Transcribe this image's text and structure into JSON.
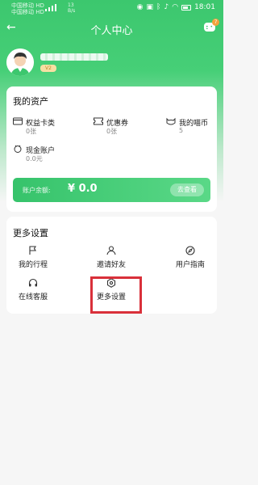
{
  "status_bar": {
    "carrier1": "中国移动 HD",
    "carrier2": "中国移动 HD",
    "speed": "13",
    "speed_unit": "B/s",
    "time": "18:01"
  },
  "nav": {
    "title": "个人中心",
    "chat_badge": "7"
  },
  "profile": {
    "level_badge": "V2"
  },
  "assets": {
    "title": "我的资产",
    "items": [
      {
        "label": "权益卡类",
        "value": "0张",
        "icon": "card-icon"
      },
      {
        "label": "优惠券",
        "value": "0张",
        "icon": "coupon-icon"
      },
      {
        "label": "我的喵币",
        "value": "5",
        "icon": "cat-coin-icon"
      },
      {
        "label": "现金账户",
        "value": "0.0元",
        "icon": "wallet-icon"
      }
    ],
    "balance": {
      "label": "账户余额:",
      "value": "¥ 0.0",
      "button": "去查看"
    }
  },
  "more_settings": {
    "title": "更多设置",
    "items": [
      {
        "label": "我的行程",
        "icon": "flag-icon"
      },
      {
        "label": "邀请好友",
        "icon": "invite-icon"
      },
      {
        "label": "用户指南",
        "icon": "compass-icon"
      },
      {
        "label": "在线客服",
        "icon": "headset-icon"
      },
      {
        "label": "更多设置",
        "icon": "settings-icon"
      }
    ]
  },
  "colors": {
    "primary": "#3cc76e",
    "highlight": "#d9303a",
    "accent": "#f4a33c"
  }
}
